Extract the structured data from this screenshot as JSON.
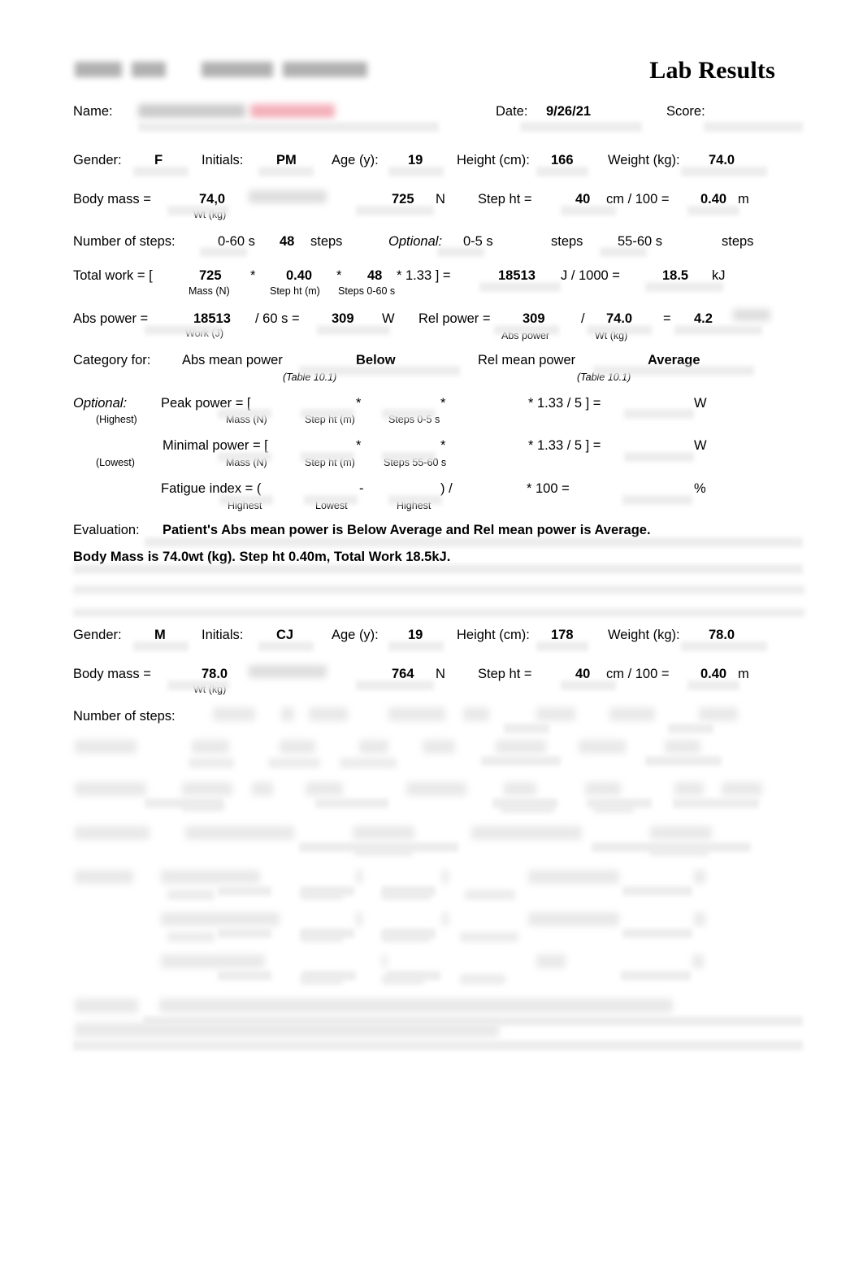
{
  "document": {
    "header_title_redacted": "",
    "lab_results_title": "Lab Results",
    "name_label": "Name:",
    "name_value_redacted": "",
    "date_label": "Date:",
    "date_value": "9/26/21",
    "score_label": "Score:",
    "score_value": ""
  },
  "record1": {
    "demographics": {
      "gender_label": "Gender:",
      "gender_value": "F",
      "initials_label": "Initials:",
      "initials_value": "PM",
      "age_label": "Age (y):",
      "age_value": "19",
      "height_label": "Height (cm):",
      "height_value": "166",
      "weight_label": "Weight (kg):",
      "weight_value": "74.0"
    },
    "body_mass": {
      "label": "Body mass  =",
      "wt_value": "74,0",
      "wt_sub": "Wt (kg)",
      "mid_redacted": "",
      "newtons_value": "725",
      "newtons_unit": "N",
      "step_ht_label": "Step ht  =",
      "step_ht_cm": "40",
      "cm_per_100": "cm / 100  =",
      "step_ht_m": "0.40",
      "m_unit": "m"
    },
    "steps": {
      "label": "Number of steps:",
      "range_full": "0-60 s",
      "count_full": "48",
      "steps_word_1": "steps",
      "optional_label": "Optional:",
      "range_peak": "0-5 s",
      "count_peak": "",
      "steps_word_2": "steps",
      "range_min": "55-60 s",
      "count_min": "",
      "steps_word_3": "steps"
    },
    "total_work": {
      "label": "Total work  =  [",
      "mass_n": "725",
      "mass_sub": "Mass (N)",
      "op1": "*",
      "step_ht_m": "0.40",
      "step_sub": "Step ht (m)",
      "op2": "*",
      "steps": "48",
      "steps_sub": "Steps 0-60 s",
      "const": "* 1.33  ]  =",
      "joules": "18513",
      "j_div": "J  /  1000  =",
      "kilojoules": "18.5",
      "kj_unit": "kJ"
    },
    "power": {
      "abs_label": "Abs power =",
      "abs_work": "18513",
      "abs_work_sub": "Work (J)",
      "abs_div": "/  60 s  =",
      "abs_value": "309",
      "abs_unit": "W",
      "rel_label": "Rel power =",
      "rel_abs": "309",
      "rel_abs_sub": "Abs power",
      "rel_slash": "/",
      "rel_wt": "74.0",
      "rel_wt_sub": "Wt (kg)",
      "rel_eq": "=",
      "rel_value": "4.2",
      "rel_unit_redacted": ""
    },
    "category": {
      "label": "Category for:",
      "abs_text": "Abs mean power",
      "abs_rating": "Below",
      "abs_table_ref": "(Table 10.1)",
      "rel_text": "Rel mean power",
      "rel_rating": "Average",
      "rel_table_ref": "(Table 10.1)"
    },
    "optional": {
      "optional_label": "Optional:",
      "peak_label": "Peak power  =   [",
      "peak_sub": "(Highest)",
      "peak_mass": "",
      "peak_mass_sub": "Mass (N)",
      "peak_op1": "*",
      "peak_step": "",
      "peak_step_sub": "Step ht (m)",
      "peak_op2": "*",
      "peak_steps": "",
      "peak_steps_sub": "Steps 0-5 s",
      "peak_const": "* 1.33 / 5 ]  =",
      "peak_result": "",
      "peak_unit": "W",
      "min_label": "Minimal power  = [",
      "min_sub": "(Lowest)",
      "min_mass": "",
      "min_mass_sub": "Mass (N)",
      "min_op1": "*",
      "min_step": "",
      "min_step_sub": "Step ht (m)",
      "min_op2": "*",
      "min_steps": "",
      "min_steps_sub": "Steps 55-60 s",
      "min_const": "* 1.33 / 5 ]  =",
      "min_result": "",
      "min_unit": "W",
      "fatigue_label": "Fatigue index  =  (",
      "fatigue_high": "",
      "fatigue_high_sub": "Highest",
      "fatigue_minus": "-",
      "fatigue_low": "",
      "fatigue_low_sub": "Lowest",
      "fatigue_close": ")  /",
      "fatigue_high2": "",
      "fatigue_high2_sub": "Highest",
      "fatigue_x100": "*  100   =",
      "fatigue_result": "",
      "fatigue_unit": "%"
    },
    "evaluation": {
      "label": "Evaluation:",
      "line1": "Patient's Abs mean power is Below Average and Rel mean power is Average.",
      "line2": "Body Mass is 74.0wt (kg). Step ht 0.40m, Total Work 18.5kJ."
    }
  },
  "record2": {
    "demographics": {
      "gender_label": "Gender:",
      "gender_value": "M",
      "initials_label": "Initials:",
      "initials_value": "CJ",
      "age_label": "Age (y):",
      "age_value": "19",
      "height_label": "Height (cm):",
      "height_value": "178",
      "weight_label": "Weight (kg):",
      "weight_value": "78.0"
    },
    "body_mass": {
      "label": "Body mass  =",
      "wt_value": "78.0",
      "wt_sub": "Wt (kg)",
      "mid_redacted": "",
      "newtons_value": "764",
      "newtons_unit": "N",
      "step_ht_label": "Step ht  =",
      "step_ht_cm": "40",
      "cm_per_100": "cm / 100  =",
      "step_ht_m": "0.40",
      "m_unit": "m"
    },
    "steps": {
      "label": "Number of steps:"
    },
    "redacted_note": ""
  }
}
